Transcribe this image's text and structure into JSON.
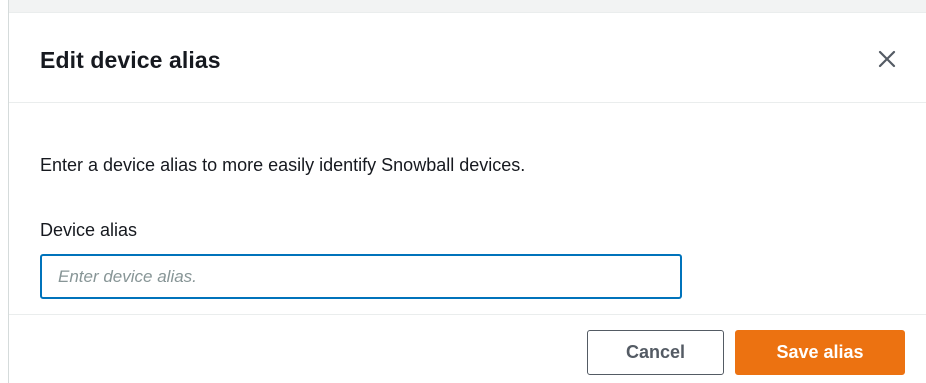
{
  "modal": {
    "title": "Edit device alias",
    "close_icon": "close-icon"
  },
  "body": {
    "description": "Enter a device alias to more easily identify Snowball devices.",
    "alias_label": "Device alias",
    "alias_value": "",
    "alias_placeholder": "Enter device alias."
  },
  "footer": {
    "cancel_label": "Cancel",
    "save_label": "Save alias"
  },
  "colors": {
    "primary_button": "#ec7211",
    "input_focus_border": "#0073bb",
    "text": "#16191f",
    "secondary_button_text": "#545b64"
  }
}
